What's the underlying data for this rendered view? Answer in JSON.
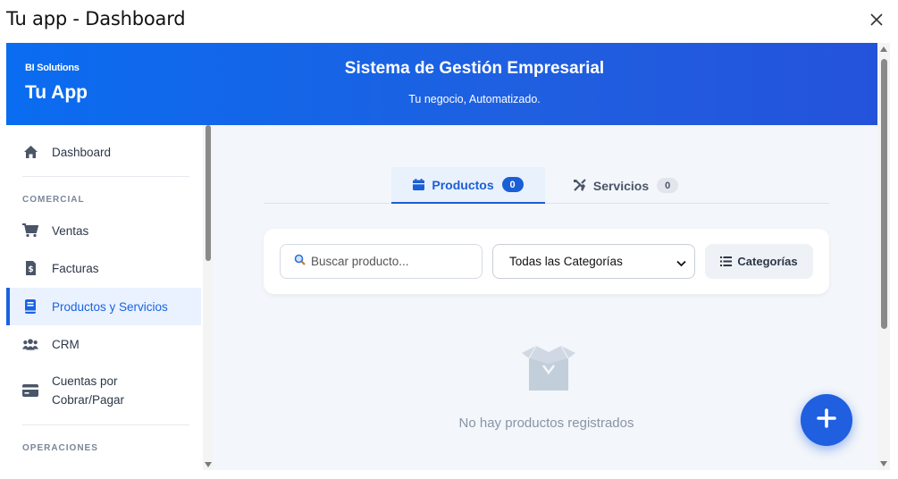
{
  "window": {
    "title": "Tu app - Dashboard",
    "close_icon": "close-icon"
  },
  "header": {
    "brand_small": "BI Solutions",
    "brand_name": "Tu App",
    "title": "Sistema de Gestión Empresarial",
    "subtitle": "Tu negocio, Automatizado."
  },
  "sidebar": {
    "dashboard": {
      "label": "Dashboard",
      "icon": "home-icon"
    },
    "section_comercial": "COMERCIAL",
    "ventas": {
      "label": "Ventas",
      "icon": "cart-icon"
    },
    "facturas": {
      "label": "Facturas",
      "icon": "invoice-icon"
    },
    "productos": {
      "label": "Productos y Servicios",
      "icon": "book-icon",
      "active": true
    },
    "crm": {
      "label": "CRM",
      "icon": "users-icon"
    },
    "cuentas": {
      "label_line1": "Cuentas por",
      "label_line2": "Cobrar/Pagar",
      "icon": "credit-card-icon"
    },
    "section_operaciones": "OPERACIONES"
  },
  "tabs": {
    "productos": {
      "label": "Productos",
      "count": "0",
      "icon": "calendar-box-icon"
    },
    "servicios": {
      "label": "Servicios",
      "count": "0",
      "icon": "tools-icon"
    }
  },
  "filters": {
    "search_placeholder": "Buscar producto...",
    "category_selected": "Todas las Categorías",
    "categories_button": "Categorías"
  },
  "empty_state": {
    "message": "No hay productos registrados",
    "icon": "open-box-icon"
  },
  "fab": {
    "icon": "plus-icon"
  },
  "colors": {
    "primary": "#1f5fe0",
    "header_start": "#0a6cf0",
    "header_end": "#2453db",
    "active_bg": "#eaf2ff"
  }
}
